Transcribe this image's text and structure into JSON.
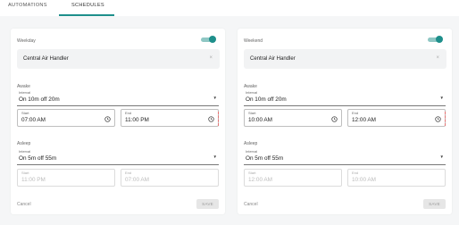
{
  "tabs": [
    {
      "label": "AUTOMATIONS"
    },
    {
      "label": "SCHEDULES"
    }
  ],
  "colors": {
    "accent": "#1e8f8b",
    "accent_light": "#8fc7c4",
    "background": "#f5f6f7"
  },
  "cards": [
    {
      "schedule_label": "Weekday",
      "enabled": true,
      "device": "Central Air Handler",
      "awake": {
        "section_label": "Awake",
        "interval_label": "Interval",
        "interval_value": "On 10m off 20m",
        "start_label": "Start",
        "start_value": "07:00 AM",
        "end_label": "End",
        "end_value": "11:00 PM"
      },
      "asleep": {
        "section_label": "Asleep",
        "interval_label": "Interval",
        "interval_value": "On 5m off 55m",
        "start_label": "Start",
        "start_value": "11:00 PM",
        "end_label": "End",
        "end_value": "07:00 AM"
      },
      "cancel_label": "Cancel",
      "save_label": "SAVE"
    },
    {
      "schedule_label": "Weekend",
      "enabled": true,
      "device": "Central Air Handler",
      "awake": {
        "section_label": "Awake",
        "interval_label": "Interval",
        "interval_value": "On 10m off 20m",
        "start_label": "Start",
        "start_value": "10:00 AM",
        "end_label": "End",
        "end_value": "12:00 AM"
      },
      "asleep": {
        "section_label": "Asleep",
        "interval_label": "Interval",
        "interval_value": "On 5m off 55m",
        "start_label": "Start",
        "start_value": "12:00 AM",
        "end_label": "End",
        "end_value": "10:00 AM"
      },
      "cancel_label": "Cancel",
      "save_label": "SAVE"
    }
  ]
}
